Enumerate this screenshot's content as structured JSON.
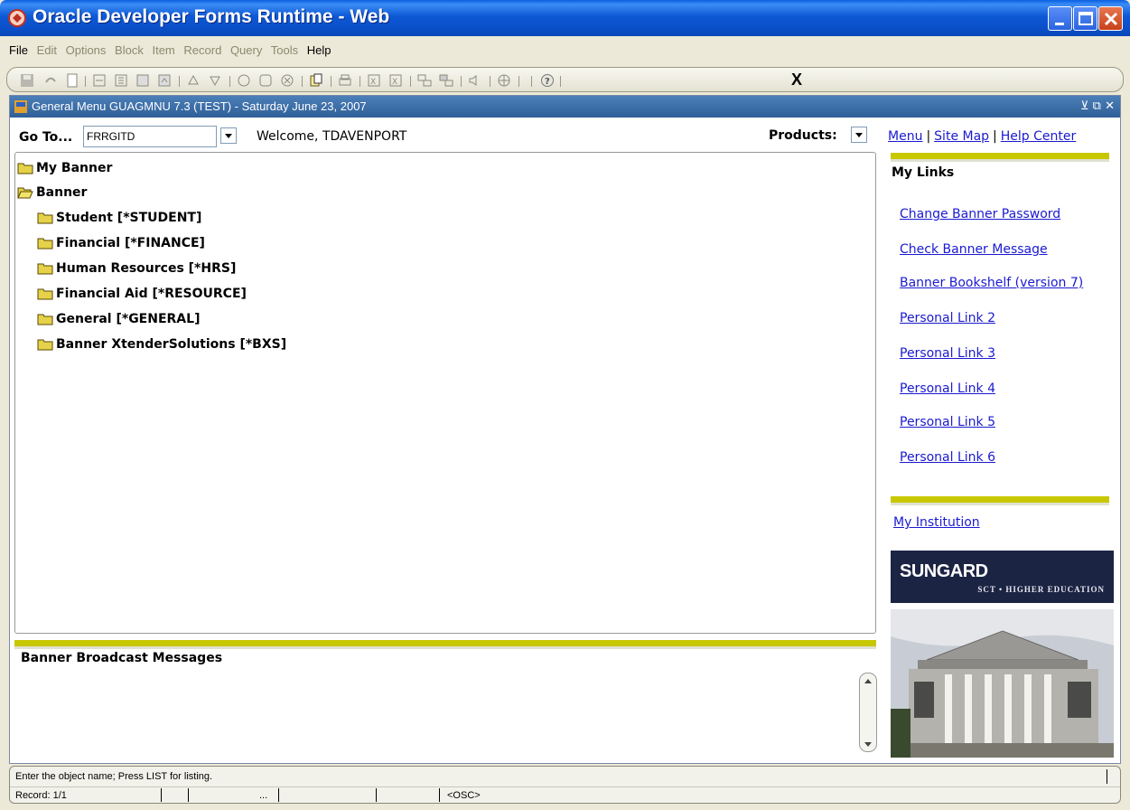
{
  "window": {
    "title": "Oracle Developer Forms Runtime - Web"
  },
  "menubar": {
    "items": [
      {
        "label": "File",
        "enabled": true
      },
      {
        "label": "Edit",
        "enabled": false
      },
      {
        "label": "Options",
        "enabled": false
      },
      {
        "label": "Block",
        "enabled": false
      },
      {
        "label": "Item",
        "enabled": false
      },
      {
        "label": "Record",
        "enabled": false
      },
      {
        "label": "Query",
        "enabled": false
      },
      {
        "label": "Tools",
        "enabled": false
      },
      {
        "label": "Help",
        "enabled": true
      }
    ]
  },
  "toolbar": {
    "exit_label": "X"
  },
  "form": {
    "title": "General Menu  GUAGMNU  7.3  (TEST) - Saturday June 23, 2007",
    "goto_label": "Go To...",
    "goto_value": "FRRGITD",
    "welcome": "Welcome, TDAVENPORT",
    "products_label": "Products:"
  },
  "tree": {
    "my_banner": "My Banner",
    "banner": "Banner",
    "children": [
      "Student [*STUDENT]",
      "Financial [*FINANCE]",
      "Human Resources [*HRS]",
      "Financial Aid [*RESOURCE]",
      "General [*GENERAL]",
      "Banner XtenderSolutions [*BXS]"
    ]
  },
  "broadcast": {
    "title": "Banner Broadcast Messages"
  },
  "right": {
    "menu": "Menu",
    "site_map": "Site Map",
    "help_center": "Help Center",
    "my_links_title": "My Links",
    "links": [
      "Change Banner Password",
      "Check Banner Message",
      "Banner Bookshelf (version 7)",
      "Personal Link 2",
      "Personal Link 3",
      "Personal Link 4",
      "Personal Link 5",
      "Personal Link 6"
    ],
    "my_institution": "My Institution"
  },
  "logo": {
    "brand": "SUNGARD",
    "sub": "SCT • HIGHER EDUCATION"
  },
  "status": {
    "message": "Enter the object name; Press LIST for listing.",
    "record": "Record: 1/1",
    "dots": "...",
    "osc": "<OSC>"
  }
}
